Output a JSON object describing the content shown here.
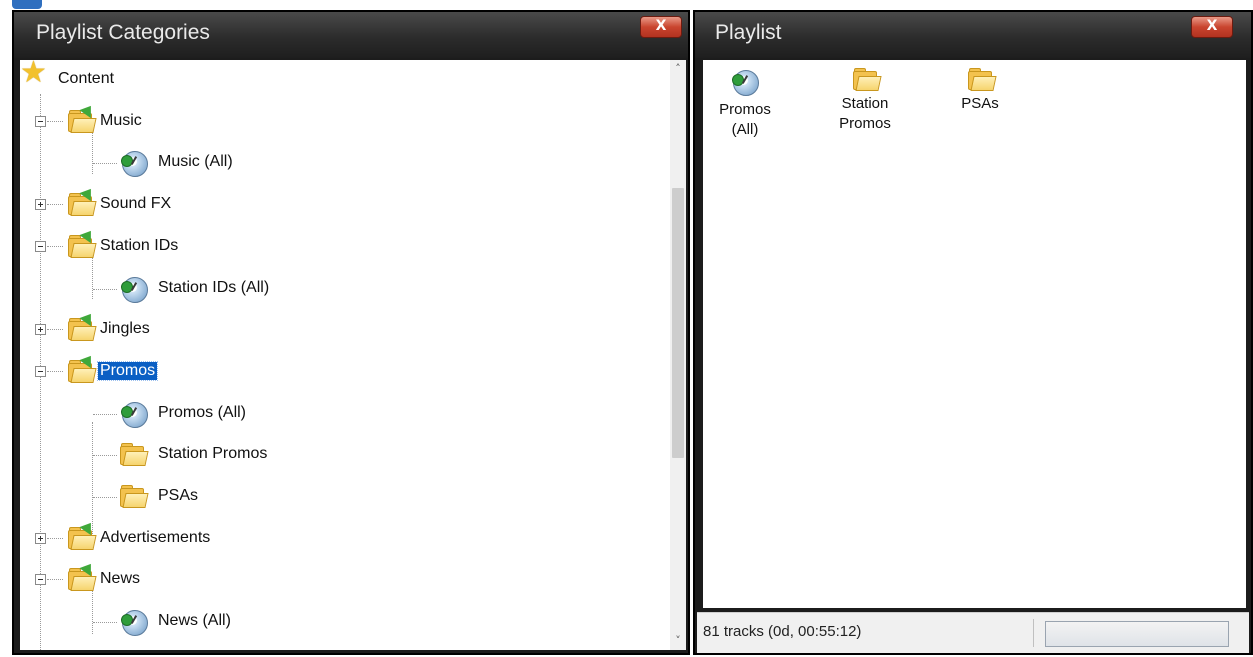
{
  "left_panel": {
    "title": "Playlist Categories",
    "close_label": "X",
    "tree": [
      {
        "label": "Content",
        "icon": "star-icon",
        "level": 0
      },
      {
        "label": "Music",
        "icon": "folder-icon",
        "level": 1,
        "expander": "minus"
      },
      {
        "label": "Music (All)",
        "icon": "playlist-icon",
        "level": 2
      },
      {
        "label": "Sound FX",
        "icon": "folder-icon",
        "level": 1,
        "expander": "plus"
      },
      {
        "label": "Station IDs",
        "icon": "folder-icon",
        "level": 1,
        "expander": "minus"
      },
      {
        "label": "Station IDs (All)",
        "icon": "playlist-icon",
        "level": 2
      },
      {
        "label": "Jingles",
        "icon": "folder-icon",
        "level": 1,
        "expander": "plus"
      },
      {
        "label": "Promos",
        "icon": "folder-icon",
        "level": 1,
        "expander": "minus",
        "selected": true
      },
      {
        "label": "Promos (All)",
        "icon": "playlist-icon",
        "level": 2
      },
      {
        "label": "Station Promos",
        "icon": "folder-icon",
        "level": 2
      },
      {
        "label": "PSAs",
        "icon": "folder-icon",
        "level": 2
      },
      {
        "label": "Advertisements",
        "icon": "folder-icon",
        "level": 1,
        "expander": "plus"
      },
      {
        "label": "News",
        "icon": "folder-icon",
        "level": 1,
        "expander": "minus"
      },
      {
        "label": "News (All)",
        "icon": "playlist-icon",
        "level": 2
      }
    ]
  },
  "right_panel": {
    "title": "Playlist",
    "close_label": "X",
    "items": [
      {
        "label": "Promos (All)",
        "icon": "playlist-icon"
      },
      {
        "label": "Station Promos",
        "icon": "folder-icon"
      },
      {
        "label": "PSAs",
        "icon": "folder-icon"
      }
    ],
    "status": "81 tracks (0d, 00:55:12)"
  },
  "colors": {
    "selection": "#0a5fc4",
    "title_bar": "#2c2c2c",
    "close_button": "#c9452f",
    "folder": "#f3c24e"
  }
}
